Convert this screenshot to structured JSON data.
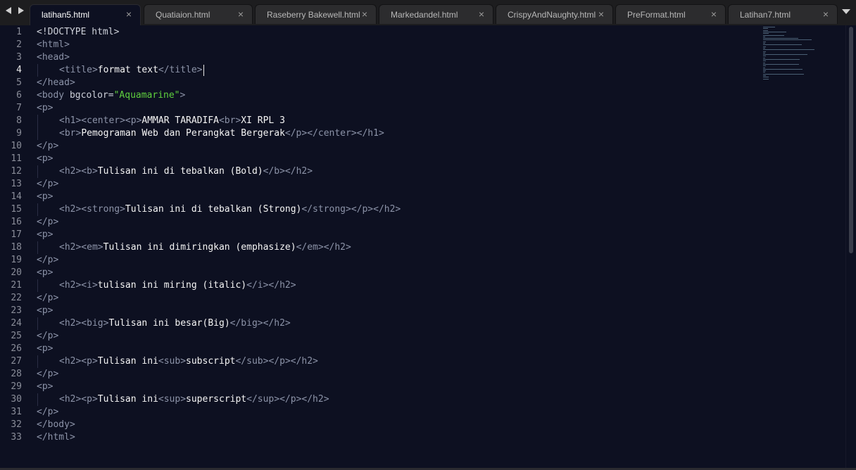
{
  "tabs": [
    {
      "label": "latihan5.html",
      "active": true
    },
    {
      "label": "Quatiaion.html",
      "active": false
    },
    {
      "label": "Raseberry Bakewell.html",
      "active": false
    },
    {
      "label": "Markedandel.html",
      "active": false
    },
    {
      "label": "CrispyAndNaughty.html",
      "active": false
    },
    {
      "label": "PreFormat.html",
      "active": false
    },
    {
      "label": "Latihan7.html",
      "active": false
    }
  ],
  "tab_close_glyph": "×",
  "icons": {
    "nav_left": "triangle-left-icon",
    "nav_right": "triangle-right-icon",
    "tab_close": "close-icon",
    "tab_list": "chevron-down-icon"
  },
  "editor": {
    "current_line": 4,
    "colors": {
      "background": "#0d1021",
      "tag": "#8c93a8",
      "text": "#f5f5f5",
      "string": "#5fd03e"
    },
    "lines": [
      {
        "n": 1,
        "indent": 0,
        "tokens": [
          [
            "dt",
            "<!DOCTYPE html>"
          ]
        ]
      },
      {
        "n": 2,
        "indent": 0,
        "tokens": [
          [
            "tg",
            "<html>"
          ]
        ]
      },
      {
        "n": 3,
        "indent": 0,
        "tokens": [
          [
            "tg",
            "<head>"
          ]
        ]
      },
      {
        "n": 4,
        "indent": 1,
        "tokens": [
          [
            "tg",
            "<title>"
          ],
          [
            "tx",
            "format text"
          ],
          [
            "tg",
            "</title>"
          ]
        ]
      },
      {
        "n": 5,
        "indent": 0,
        "tokens": [
          [
            "tg",
            "</head>"
          ]
        ]
      },
      {
        "n": 6,
        "indent": 0,
        "tokens": [
          [
            "tg",
            "<body "
          ],
          [
            "at",
            "bgcolor="
          ],
          [
            "st",
            "\"Aquamarine\""
          ],
          [
            "tg",
            ">"
          ]
        ]
      },
      {
        "n": 7,
        "indent": 0,
        "tokens": [
          [
            "tg",
            "<p>"
          ]
        ]
      },
      {
        "n": 8,
        "indent": 1,
        "tokens": [
          [
            "tg",
            "<h1><center><p>"
          ],
          [
            "tx",
            "AMMAR TARADIFA"
          ],
          [
            "tg",
            "<br>"
          ],
          [
            "tx",
            "XI RPL 3"
          ]
        ]
      },
      {
        "n": 9,
        "indent": 1,
        "tokens": [
          [
            "tg",
            "<br>"
          ],
          [
            "tx",
            "Pemograman Web dan Perangkat Bergerak"
          ],
          [
            "tg",
            "</p></center></h1>"
          ]
        ]
      },
      {
        "n": 10,
        "indent": 0,
        "tokens": [
          [
            "tg",
            "</p>"
          ]
        ]
      },
      {
        "n": 11,
        "indent": 0,
        "tokens": [
          [
            "tg",
            "<p>"
          ]
        ]
      },
      {
        "n": 12,
        "indent": 1,
        "tokens": [
          [
            "tg",
            "<h2><b>"
          ],
          [
            "tx",
            "Tulisan ini di tebalkan (Bold)"
          ],
          [
            "tg",
            "</b></h2>"
          ]
        ]
      },
      {
        "n": 13,
        "indent": 0,
        "tokens": [
          [
            "tg",
            "</p>"
          ]
        ]
      },
      {
        "n": 14,
        "indent": 0,
        "tokens": [
          [
            "tg",
            "<p>"
          ]
        ]
      },
      {
        "n": 15,
        "indent": 1,
        "tokens": [
          [
            "tg",
            "<h2><strong>"
          ],
          [
            "tx",
            "Tulisan ini di tebalkan (Strong)"
          ],
          [
            "tg",
            "</strong></p></h2>"
          ]
        ]
      },
      {
        "n": 16,
        "indent": 0,
        "tokens": [
          [
            "tg",
            "</p>"
          ]
        ]
      },
      {
        "n": 17,
        "indent": 0,
        "tokens": [
          [
            "tg",
            "<p>"
          ]
        ]
      },
      {
        "n": 18,
        "indent": 1,
        "tokens": [
          [
            "tg",
            "<h2><em>"
          ],
          [
            "tx",
            "Tulisan ini dimiringkan (emphasize)"
          ],
          [
            "tg",
            "</em></h2>"
          ]
        ]
      },
      {
        "n": 19,
        "indent": 0,
        "tokens": [
          [
            "tg",
            "</p>"
          ]
        ]
      },
      {
        "n": 20,
        "indent": 0,
        "tokens": [
          [
            "tg",
            "<p>"
          ]
        ]
      },
      {
        "n": 21,
        "indent": 1,
        "tokens": [
          [
            "tg",
            "<h2><i>"
          ],
          [
            "tx",
            "tulisan ini miring (italic)"
          ],
          [
            "tg",
            "</i></h2>"
          ]
        ]
      },
      {
        "n": 22,
        "indent": 0,
        "tokens": [
          [
            "tg",
            "</p>"
          ]
        ]
      },
      {
        "n": 23,
        "indent": 0,
        "tokens": [
          [
            "tg",
            "<p>"
          ]
        ]
      },
      {
        "n": 24,
        "indent": 1,
        "tokens": [
          [
            "tg",
            "<h2><big>"
          ],
          [
            "tx",
            "Tulisan ini besar(Big)"
          ],
          [
            "tg",
            "</big></h2>"
          ]
        ]
      },
      {
        "n": 25,
        "indent": 0,
        "tokens": [
          [
            "tg",
            "</p>"
          ]
        ]
      },
      {
        "n": 26,
        "indent": 0,
        "tokens": [
          [
            "tg",
            "<p>"
          ]
        ]
      },
      {
        "n": 27,
        "indent": 1,
        "tokens": [
          [
            "tg",
            "<h2><p>"
          ],
          [
            "tx",
            "Tulisan ini"
          ],
          [
            "tg",
            "<sub>"
          ],
          [
            "tx",
            "subscript"
          ],
          [
            "tg",
            "</sub></p></h2>"
          ]
        ]
      },
      {
        "n": 28,
        "indent": 0,
        "tokens": [
          [
            "tg",
            "</p>"
          ]
        ]
      },
      {
        "n": 29,
        "indent": 0,
        "tokens": [
          [
            "tg",
            "<p>"
          ]
        ]
      },
      {
        "n": 30,
        "indent": 1,
        "tokens": [
          [
            "tg",
            "<h2><p>"
          ],
          [
            "tx",
            "Tulisan ini"
          ],
          [
            "tg",
            "<sup>"
          ],
          [
            "tx",
            "superscript"
          ],
          [
            "tg",
            "</sup></p></h2>"
          ]
        ]
      },
      {
        "n": 31,
        "indent": 0,
        "tokens": [
          [
            "tg",
            "</p>"
          ]
        ]
      },
      {
        "n": 32,
        "indent": 0,
        "tokens": [
          [
            "tg",
            "</body>"
          ]
        ]
      },
      {
        "n": 33,
        "indent": 0,
        "tokens": [
          [
            "tg",
            "</html>"
          ]
        ]
      }
    ]
  }
}
